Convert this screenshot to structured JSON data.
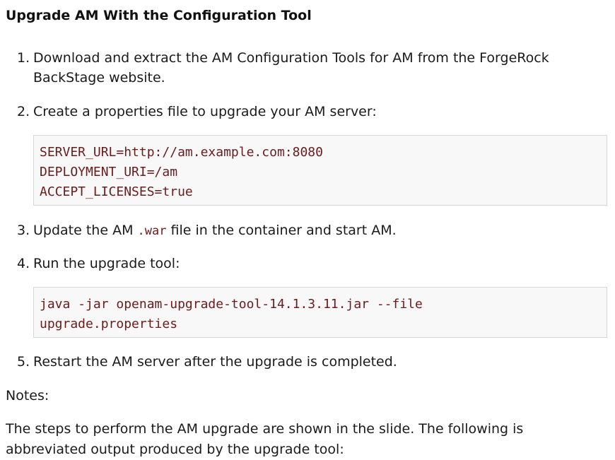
{
  "title": "Upgrade AM With the Configuration Tool",
  "steps": [
    {
      "number": "1.",
      "line1": "Download and extract the AM Configuration Tools for AM from the ForgeRock",
      "line2": "BackStage website."
    },
    {
      "number": "2.",
      "text": "Create a properties file to upgrade your AM server:"
    },
    {
      "number": "3.",
      "before": "Update the AM ",
      "code": ".war",
      "after": " file in the container and start AM."
    },
    {
      "number": "4.",
      "text": "Run the upgrade tool:"
    },
    {
      "number": "5.",
      "text": "Restart the AM server after the upgrade is completed."
    }
  ],
  "properties_code": [
    "SERVER_URL=http://am.example.com:8080",
    "DEPLOYMENT_URI=/am",
    "ACCEPT_LICENSES=true"
  ],
  "command_code": [
    "java -jar openam-upgrade-tool-14.1.3.11.jar --file",
    "upgrade.properties"
  ],
  "notes_label": "Notes:",
  "notes_text": "The steps to perform the AM upgrade are shown in the slide. The following is abbreviated output produced by the upgrade tool:"
}
